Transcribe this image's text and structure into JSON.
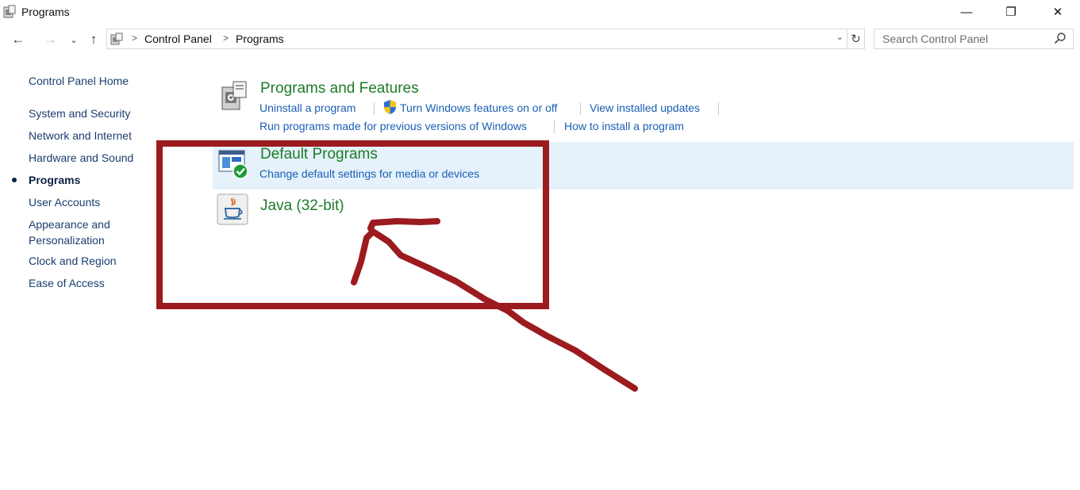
{
  "window": {
    "title": "Programs",
    "controls": {
      "minimize": "—",
      "maximize": "❐",
      "close": "✕"
    }
  },
  "nav": {
    "back": "←",
    "forward": "→",
    "recent": "⌄",
    "up": "↑",
    "breadcrumb": [
      {
        "label": "Control Panel"
      },
      {
        "label": "Programs"
      }
    ],
    "crumb_separator": ">",
    "dropdown": "⌄",
    "refresh": "↻",
    "search_placeholder": "Search Control Panel"
  },
  "sidebar": {
    "home": "Control Panel Home",
    "items": [
      {
        "label": "System and Security"
      },
      {
        "label": "Network and Internet"
      },
      {
        "label": "Hardware and Sound"
      },
      {
        "label": "Programs",
        "current": true
      },
      {
        "label": "User Accounts"
      },
      {
        "label": "Appearance and"
      },
      {
        "label": "Personalization"
      },
      {
        "label": "Clock and Region"
      },
      {
        "label": "Ease of Access"
      }
    ]
  },
  "categories": {
    "programs_features": {
      "title": "Programs and Features",
      "icon": "programs-features-icon",
      "links": [
        "Uninstall a program",
        "Turn Windows features on or off",
        "View installed updates",
        "Run programs made for previous versions of Windows",
        "How to install a program"
      ]
    },
    "default_programs": {
      "title": "Default Programs",
      "icon": "default-programs-icon",
      "links": [
        "Change default settings for media or devices"
      ]
    },
    "java": {
      "title": "Java (32-bit)",
      "icon": "java-icon"
    }
  },
  "colors": {
    "category_title": "#1c7d27",
    "task_link": "#1a5fb4",
    "highlight": "#e5f1fb",
    "annotation": "#9b1b1f"
  }
}
